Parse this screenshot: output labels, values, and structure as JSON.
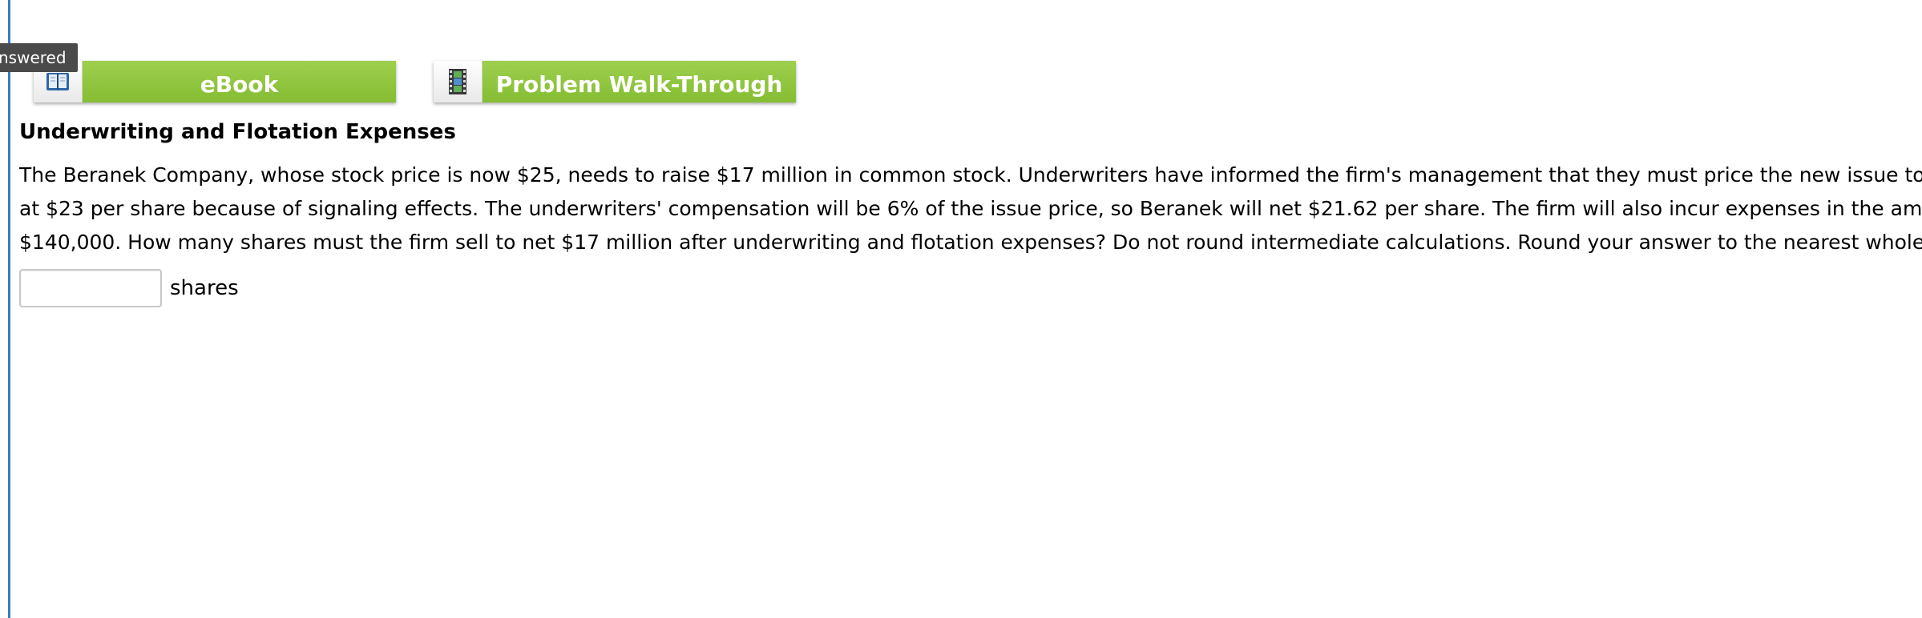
{
  "status_tab": {
    "label": "nswered"
  },
  "resources": {
    "ebook": {
      "label": "eBook",
      "icon": "book-icon"
    },
    "walkthrough": {
      "label": "Problem Walk-Through",
      "icon": "film-icon"
    }
  },
  "problem": {
    "title": "Underwriting and Flotation Expenses",
    "lines": [
      "The Beranek Company, whose stock price is now $25, needs to raise $17 million in common stock. Underwriters have informed the firm's management that they must price the new issue to the pu",
      "at $23 per share because of signaling effects. The underwriters' compensation will be 6% of the issue price, so Beranek will net $21.62 per share. The firm will also incur expenses in the amount o",
      "$140,000. How many shares must the firm sell to net $17 million after underwriting and flotation expenses? Do not round intermediate calculations. Round your answer to the nearest whole numb"
    ]
  },
  "answer": {
    "value": "",
    "placeholder": "",
    "unit": "shares"
  },
  "colors": {
    "accent_green": "#8dc63f",
    "rule_blue": "#3b7cc4",
    "tab_gray": "#4a4a4a"
  }
}
